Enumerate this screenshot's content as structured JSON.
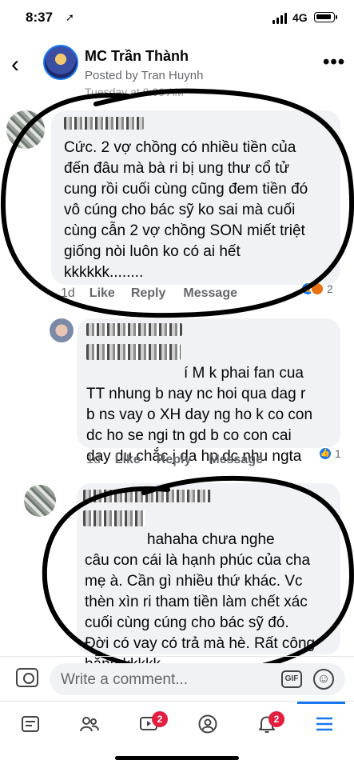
{
  "status_bar": {
    "time": "8:37",
    "location_arrow": "location-arrow-icon",
    "network": "4G"
  },
  "header": {
    "back_icon": "chevron-left-icon",
    "page_name": "MC Trần Thành",
    "posted_by": "Posted by Tran Huynh",
    "post_time_partial": "Tuesday at 8:00 AM",
    "more_label": "•••"
  },
  "comments": [
    {
      "text": "Cức. 2 vợ chồng có nhiều tiền của\nđến đâu mà bà ri bị ung thư cổ tử\ncung rồi cuối cùng cũng đem tiền đó\nvô cúng cho bác sỹ ko sai mà cuối\ncùng cẫn 2 vợ chồng SON miết triệt\ngiống nòi luôn ko có ai hết\nkkkkkk........",
      "time": "1d",
      "like": "Like",
      "reply": "Reply",
      "message": "Message",
      "reaction_count": "2"
    },
    {
      "text": "í M k phai fan cua\nTT nhung b nay nc hoi qua dag r\nb ns vay o XH day ng ho k co con\ndc ho se ngi tn gd b co con cai\nday du chắc j da hp dc nhu ngta",
      "time": "1d",
      "like": "Like",
      "reply": "Reply",
      "message": "Message",
      "reaction_count": "1"
    },
    {
      "text": "hahaha chưa nghe\ncâu con cái là hạnh phúc của cha\nmẹ à. Cần gì nhiều thứ khác. Vc\nthèn xìn ri tham tiền làm chết xác\ncuối cùng cúng cho bác sỹ đó.\nĐời có vay có trả mà hè. Rất công\nbằng kkkkk....."
    }
  ],
  "composer": {
    "placeholder": "Write a comment...",
    "gif_label": "GIF",
    "emoji_label": "☺"
  },
  "tabs": {
    "watch_badge": "2",
    "notifications_badge": "2"
  },
  "colors": {
    "accent": "#1877f2",
    "badge": "#e41e3f",
    "bubble": "#f0f2f5",
    "secondary_text": "#65676b"
  }
}
